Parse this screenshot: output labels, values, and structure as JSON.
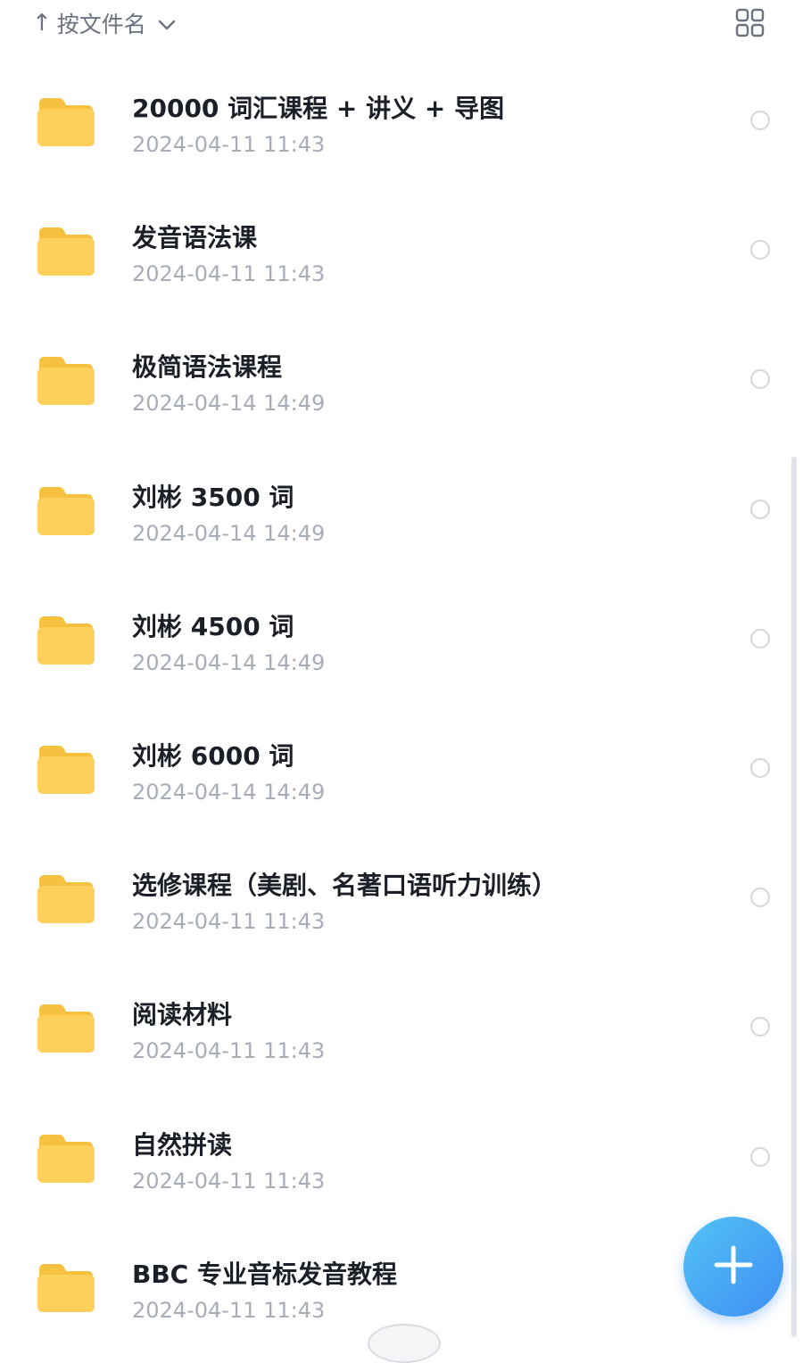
{
  "toolbar": {
    "sort_arrow": "↑",
    "sort_label": "按文件名",
    "icons": {
      "sort_arrow": "arrow-up-icon",
      "chevron": "chevron-down-icon",
      "view": "grid-view-icon"
    }
  },
  "files": [
    {
      "name": "20000 词汇课程 + 讲义 + 导图",
      "modified": "2024-04-11 11:43"
    },
    {
      "name": "发音语法课",
      "modified": "2024-04-11 11:43"
    },
    {
      "name": "极简语法课程",
      "modified": "2024-04-14 14:49"
    },
    {
      "name": "刘彬 3500 词",
      "modified": "2024-04-14 14:49"
    },
    {
      "name": "刘彬 4500 词",
      "modified": "2024-04-14 14:49"
    },
    {
      "name": "刘彬 6000 词",
      "modified": "2024-04-14 14:49"
    },
    {
      "name": "选修课程（美剧、名著口语听力训练）",
      "modified": "2024-04-11 11:43"
    },
    {
      "name": "阅读材料",
      "modified": "2024-04-11 11:43"
    },
    {
      "name": "自然拼读",
      "modified": "2024-04-11 11:43"
    },
    {
      "name": "BBC 专业音标发音教程",
      "modified": "2024-04-11 11:43"
    }
  ],
  "item_icon": "folder-icon",
  "fab": {
    "icon": "plus-icon"
  },
  "colors": {
    "folder": "#fcd05a",
    "folder_tab": "#f5c13f",
    "title_text": "#1b1f27",
    "meta_text": "#a7adb8",
    "fab_start": "#53c2f5",
    "fab_end": "#3e8ff3"
  }
}
